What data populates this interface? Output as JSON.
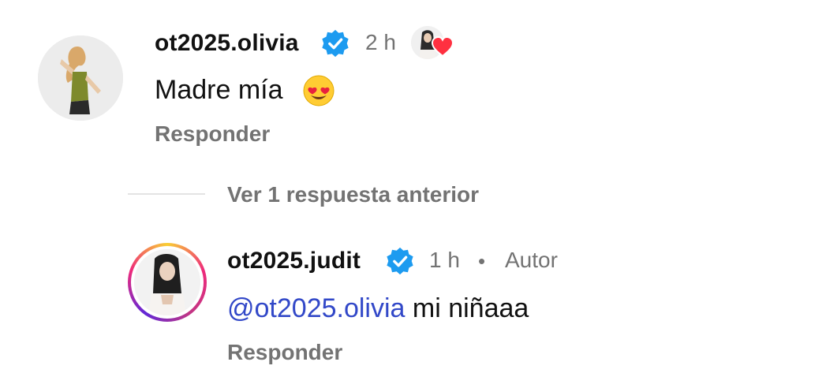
{
  "comments": [
    {
      "username": "ot2025.olivia",
      "time": "2 h",
      "text": "Madre mía",
      "reply_label": "Responder"
    }
  ],
  "view_replies_label": "Ver 1 respuesta anterior",
  "reply": {
    "username": "ot2025.judit",
    "time": "1 h",
    "separator": "•",
    "author_label": "Autor",
    "mention": "@ot2025.olivia",
    "text": " mi niñaaa",
    "reply_label": "Responder"
  },
  "colors": {
    "verified": "#1d9bf0",
    "mention": "#3248c8",
    "secondary_text": "#737373",
    "heart": "#ff3040"
  },
  "icons": [
    "verified-badge-icon",
    "heart-eyes-emoji-icon",
    "heart-icon",
    "threads-at-icon"
  ]
}
